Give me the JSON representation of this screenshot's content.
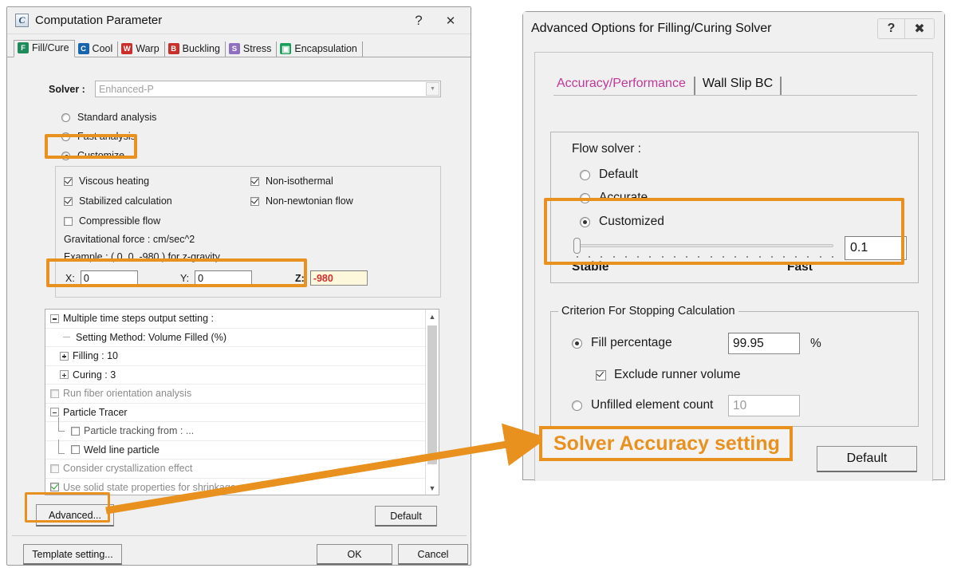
{
  "accent": {
    "orange": "#E8911F",
    "red_value": "#d32f2f",
    "magenta_tab": "#c0399a",
    "yellow_field": "#fdf8dc"
  },
  "left_dialog": {
    "app_icon_glyph": "C",
    "title": "Computation Parameter",
    "titlebar_buttons": [
      {
        "name": "help-button",
        "glyph": "?"
      },
      {
        "name": "close-button",
        "glyph": "✕"
      }
    ],
    "tabs": [
      {
        "label": "Fill/Cure",
        "icon_letter": "F",
        "icon_color": "#1f8a5a",
        "selected": true
      },
      {
        "label": "Cool",
        "icon_letter": "C",
        "icon_color": "#1763ad",
        "selected": false
      },
      {
        "label": "Warp",
        "icon_letter": "W",
        "icon_color": "#c9302c",
        "selected": false
      },
      {
        "label": "Buckling",
        "icon_letter": "B",
        "icon_color": "#c9302c",
        "selected": false
      },
      {
        "label": "Stress",
        "icon_letter": "S",
        "icon_color": "#8e6fc0",
        "selected": false
      },
      {
        "label": "Encapsulation",
        "icon_letter": "▣",
        "icon_color": "#17a05a",
        "selected": false
      }
    ],
    "solver": {
      "label": "Solver :",
      "value": "Enhanced-P",
      "disabled": true
    },
    "analysis_modes": [
      {
        "label": "Standard analysis",
        "selected": false
      },
      {
        "label": "Fast analysis",
        "selected": false
      },
      {
        "label": "Customize",
        "selected": true,
        "highlighted": true
      }
    ],
    "options": [
      {
        "label": "Viscous heating",
        "checked": true,
        "column": 1
      },
      {
        "label": "Non-isothermal",
        "checked": true,
        "column": 2
      },
      {
        "label": "Stabilized calculation",
        "checked": true,
        "column": 1
      },
      {
        "label": "Non-newtonian flow",
        "checked": true,
        "column": 2
      },
      {
        "label": "Compressible flow",
        "checked": false,
        "column": 1
      }
    ],
    "gravity": {
      "force_label": "Gravitational force :  cm/sec^2",
      "example_label": "Example : ( 0, 0, -980 ) for z-gravity",
      "fields": [
        {
          "label": "X:",
          "value": "0",
          "emphasis": false
        },
        {
          "label": "Y:",
          "value": "0",
          "emphasis": false
        },
        {
          "label": "Z:",
          "value": "-980",
          "emphasis": true
        }
      ],
      "highlighted": true
    },
    "tree": [
      {
        "label": "Multiple time steps output setting :",
        "node": "minus",
        "indent": 0,
        "control": "none",
        "dim": false
      },
      {
        "label": "Setting Method: Volume Filled (%)",
        "node": "stub",
        "indent": 1,
        "control": "none",
        "dim": false
      },
      {
        "label": "Filling :  10",
        "node": "plus",
        "indent": 0,
        "control": "none",
        "dim": false
      },
      {
        "label": "Curing :  3",
        "node": "plus",
        "indent": 0,
        "control": "none",
        "dim": false
      },
      {
        "label": "Run fiber orientation analysis",
        "node": "none",
        "indent": 0,
        "control": "checkbox",
        "checked": false,
        "dim": true
      },
      {
        "label": "Particle Tracer",
        "node": "minus",
        "indent": 0,
        "control": "none",
        "dim": false
      },
      {
        "label": "Particle tracking from : ...",
        "node": "elbow",
        "indent": 1,
        "control": "checkbox",
        "checked": false,
        "dim": false
      },
      {
        "label": "Weld line particle",
        "node": "elbow-end",
        "indent": 1,
        "control": "checkbox",
        "checked": false,
        "dim": false
      },
      {
        "label": "Consider crystallization effect",
        "node": "none",
        "indent": 0,
        "control": "checkbox",
        "checked": false,
        "dim": true
      },
      {
        "label": "Use solid state properties for shrinkage",
        "node": "none",
        "indent": 0,
        "control": "checkbox-green",
        "checked": true,
        "dim": true
      }
    ],
    "scrollbar": {
      "up_glyph": "ⱏ",
      "down_glyph": "ⱟ"
    },
    "buttons": {
      "advanced": "Advanced...",
      "advanced_highlighted": true,
      "default": "Default",
      "template_setting": "Template setting...",
      "ok": "OK",
      "cancel": "Cancel"
    }
  },
  "right_dialog": {
    "title": "Advanced Options for Filling/Curing Solver",
    "titlebar_buttons": [
      {
        "name": "help-button",
        "glyph": "?"
      },
      {
        "name": "close-button",
        "glyph": "✖"
      }
    ],
    "tabs": [
      {
        "label": "Accuracy/Performance",
        "selected": true
      },
      {
        "label": "Wall Slip BC",
        "selected": false
      }
    ],
    "flow_solver": {
      "title": "Flow solver :",
      "options": [
        {
          "label": "Default",
          "selected": false
        },
        {
          "label": "Accurate",
          "selected": false
        },
        {
          "label": "Customized",
          "selected": true
        }
      ],
      "slider": {
        "value": "0.1",
        "position_percent": 2,
        "tick_count": 22,
        "left_label": "Stable",
        "right_label": "Fast"
      },
      "highlighted": true
    },
    "stopping_criterion": {
      "title": "Criterion For Stopping Calculation",
      "fill_percentage": {
        "label": "Fill percentage",
        "selected": true,
        "value": "99.95",
        "unit": "%"
      },
      "exclude_runner": {
        "label": "Exclude runner volume",
        "checked": true
      },
      "unfilled_count": {
        "label": "Unfilled element count",
        "selected": false,
        "value": "10",
        "disabled": true
      }
    },
    "default_button": "Default"
  },
  "annotation": {
    "callout_text": "Solver Accuracy setting"
  }
}
